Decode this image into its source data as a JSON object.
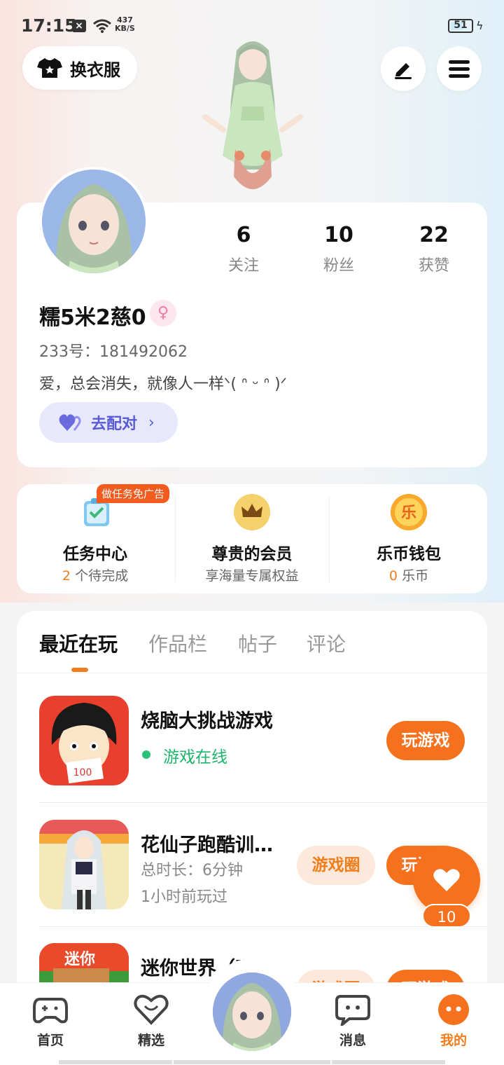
{
  "status_bar": {
    "time": "17:15",
    "speed_value": "437",
    "speed_unit": "KB/S",
    "battery": "51"
  },
  "top": {
    "outfit_label": "换衣服"
  },
  "profile": {
    "nickname": "糯5米2慈0",
    "gender_symbol": "♀",
    "uid": "233号：181492062",
    "bio": "爱，总会消失，就像人一样ᐠ( ᐢ ᵕ ᐢ )ᐟ",
    "stats": [
      {
        "num": "6",
        "label": "关注"
      },
      {
        "num": "10",
        "label": "粉丝"
      },
      {
        "num": "22",
        "label": "获赞"
      }
    ],
    "match_label": "去配对",
    "match_chevron": "›"
  },
  "services": {
    "task": {
      "badge": "做任务免广告",
      "title": "任务中心",
      "count": "2",
      "sub": "个待完成"
    },
    "vip": {
      "title": "尊贵的会员",
      "sub": "享海量专属权益"
    },
    "wallet": {
      "icon_text": "乐",
      "title": "乐币钱包",
      "count": "0",
      "sub": "乐币"
    }
  },
  "tabs": [
    "最近在玩",
    "作品栏",
    "帖子",
    "评论"
  ],
  "games": [
    {
      "name": "烧脑大挑战游戏",
      "status": "游戏在线",
      "play": "玩游戏"
    },
    {
      "name": "花仙子跑酷训…",
      "meta1": "总时长：6分钟",
      "meta2": "1小时前玩过",
      "circle": "游戏圈",
      "play": "玩游戏"
    },
    {
      "name": "迷你世界（吧",
      "circle": "游戏圈",
      "play": "玩游戏"
    }
  ],
  "like": {
    "count": "10"
  },
  "nav": [
    {
      "label": "首页",
      "icon": "gamepad-icon"
    },
    {
      "label": "精选",
      "icon": "heart-chat-icon"
    },
    {
      "label": "消息",
      "icon": "message-icon"
    },
    {
      "label": "我的",
      "icon": "me-icon"
    }
  ],
  "colors": {
    "accent": "#f6711d",
    "online": "#1fb46d",
    "match": "#5a5ad6"
  }
}
